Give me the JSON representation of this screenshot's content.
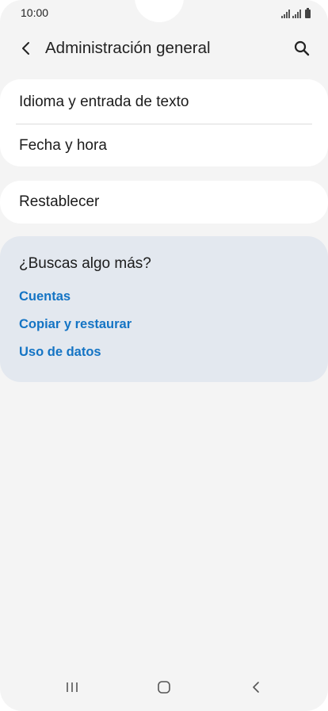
{
  "status_bar": {
    "time": "10:00",
    "icons": [
      "signal-icon",
      "signal-icon",
      "battery-icon"
    ]
  },
  "header": {
    "back_icon": "chevron-left-icon",
    "title": "Administración general",
    "search_icon": "search-icon"
  },
  "settings_list": {
    "group_1": [
      {
        "label": "Idioma y entrada de texto"
      },
      {
        "label": "Fecha y hora"
      }
    ],
    "group_2": [
      {
        "label": "Restablecer"
      }
    ]
  },
  "suggestions": {
    "title": "¿Buscas algo más?",
    "links": [
      {
        "label": "Cuentas"
      },
      {
        "label": "Copiar y restaurar"
      },
      {
        "label": "Uso de datos"
      }
    ]
  },
  "nav_bar": {
    "icons": [
      "recent-apps-icon",
      "home-icon",
      "back-icon"
    ]
  },
  "colors": {
    "background": "#f4f4f4",
    "card": "#ffffff",
    "suggest_card": "#e3e8ef",
    "link": "#1474c4",
    "text": "#1c1c1c"
  }
}
